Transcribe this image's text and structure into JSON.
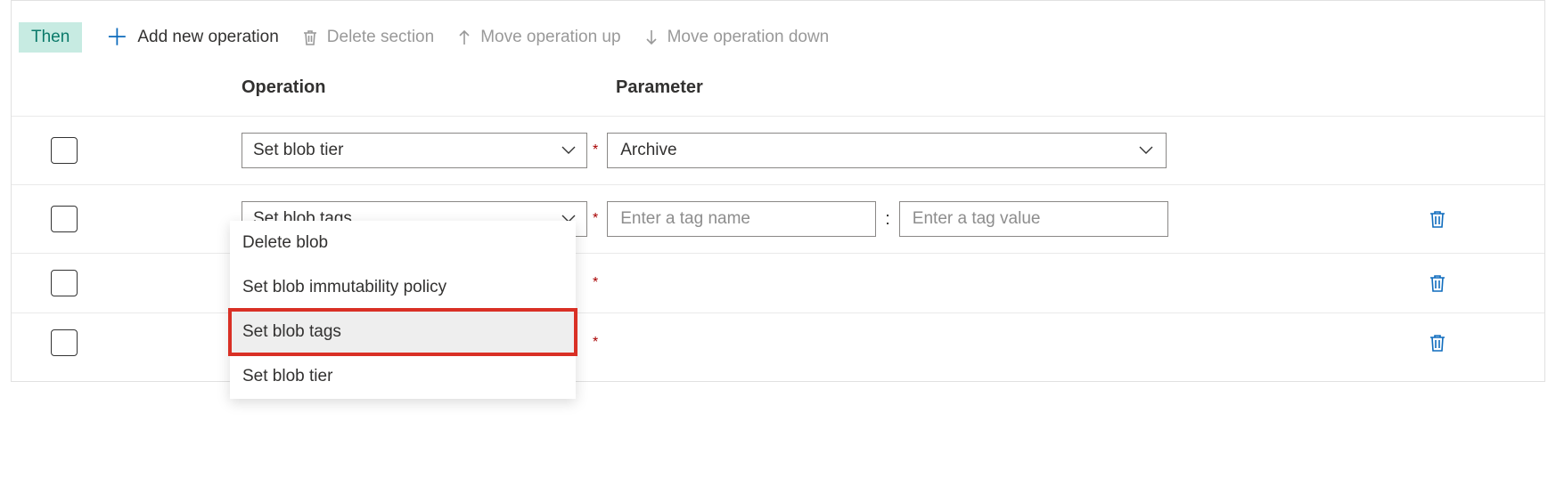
{
  "toolbar": {
    "then_label": "Then",
    "add_label": "Add new operation",
    "delete_label": "Delete section",
    "move_up_label": "Move operation up",
    "move_down_label": "Move operation down"
  },
  "headers": {
    "operation": "Operation",
    "parameter": "Parameter"
  },
  "rows": [
    {
      "operation": "Set blob tier",
      "param_kind": "select",
      "param_value": "Archive",
      "show_trash": false
    },
    {
      "operation": "Set blob tags",
      "param_kind": "tags",
      "tag_name_placeholder": "Enter a tag name",
      "tag_value_placeholder": "Enter a tag value",
      "tag_separator": ":",
      "show_trash": true
    },
    {
      "operation": "",
      "param_kind": "none",
      "show_trash": true
    },
    {
      "operation": "",
      "param_kind": "none",
      "show_trash": true
    }
  ],
  "dropdown": {
    "open_on_row": 1,
    "options": [
      {
        "label": "Delete blob",
        "highlight": false
      },
      {
        "label": "Set blob immutability policy",
        "highlight": false
      },
      {
        "label": "Set blob tags",
        "highlight": true
      },
      {
        "label": "Set blob tier",
        "highlight": false
      }
    ]
  },
  "colors": {
    "accent": "#0f6cbd",
    "then_bg": "#c7ebe2",
    "then_fg": "#0b7a6a",
    "disabled": "#999999",
    "highlight_outline": "#d93025"
  }
}
